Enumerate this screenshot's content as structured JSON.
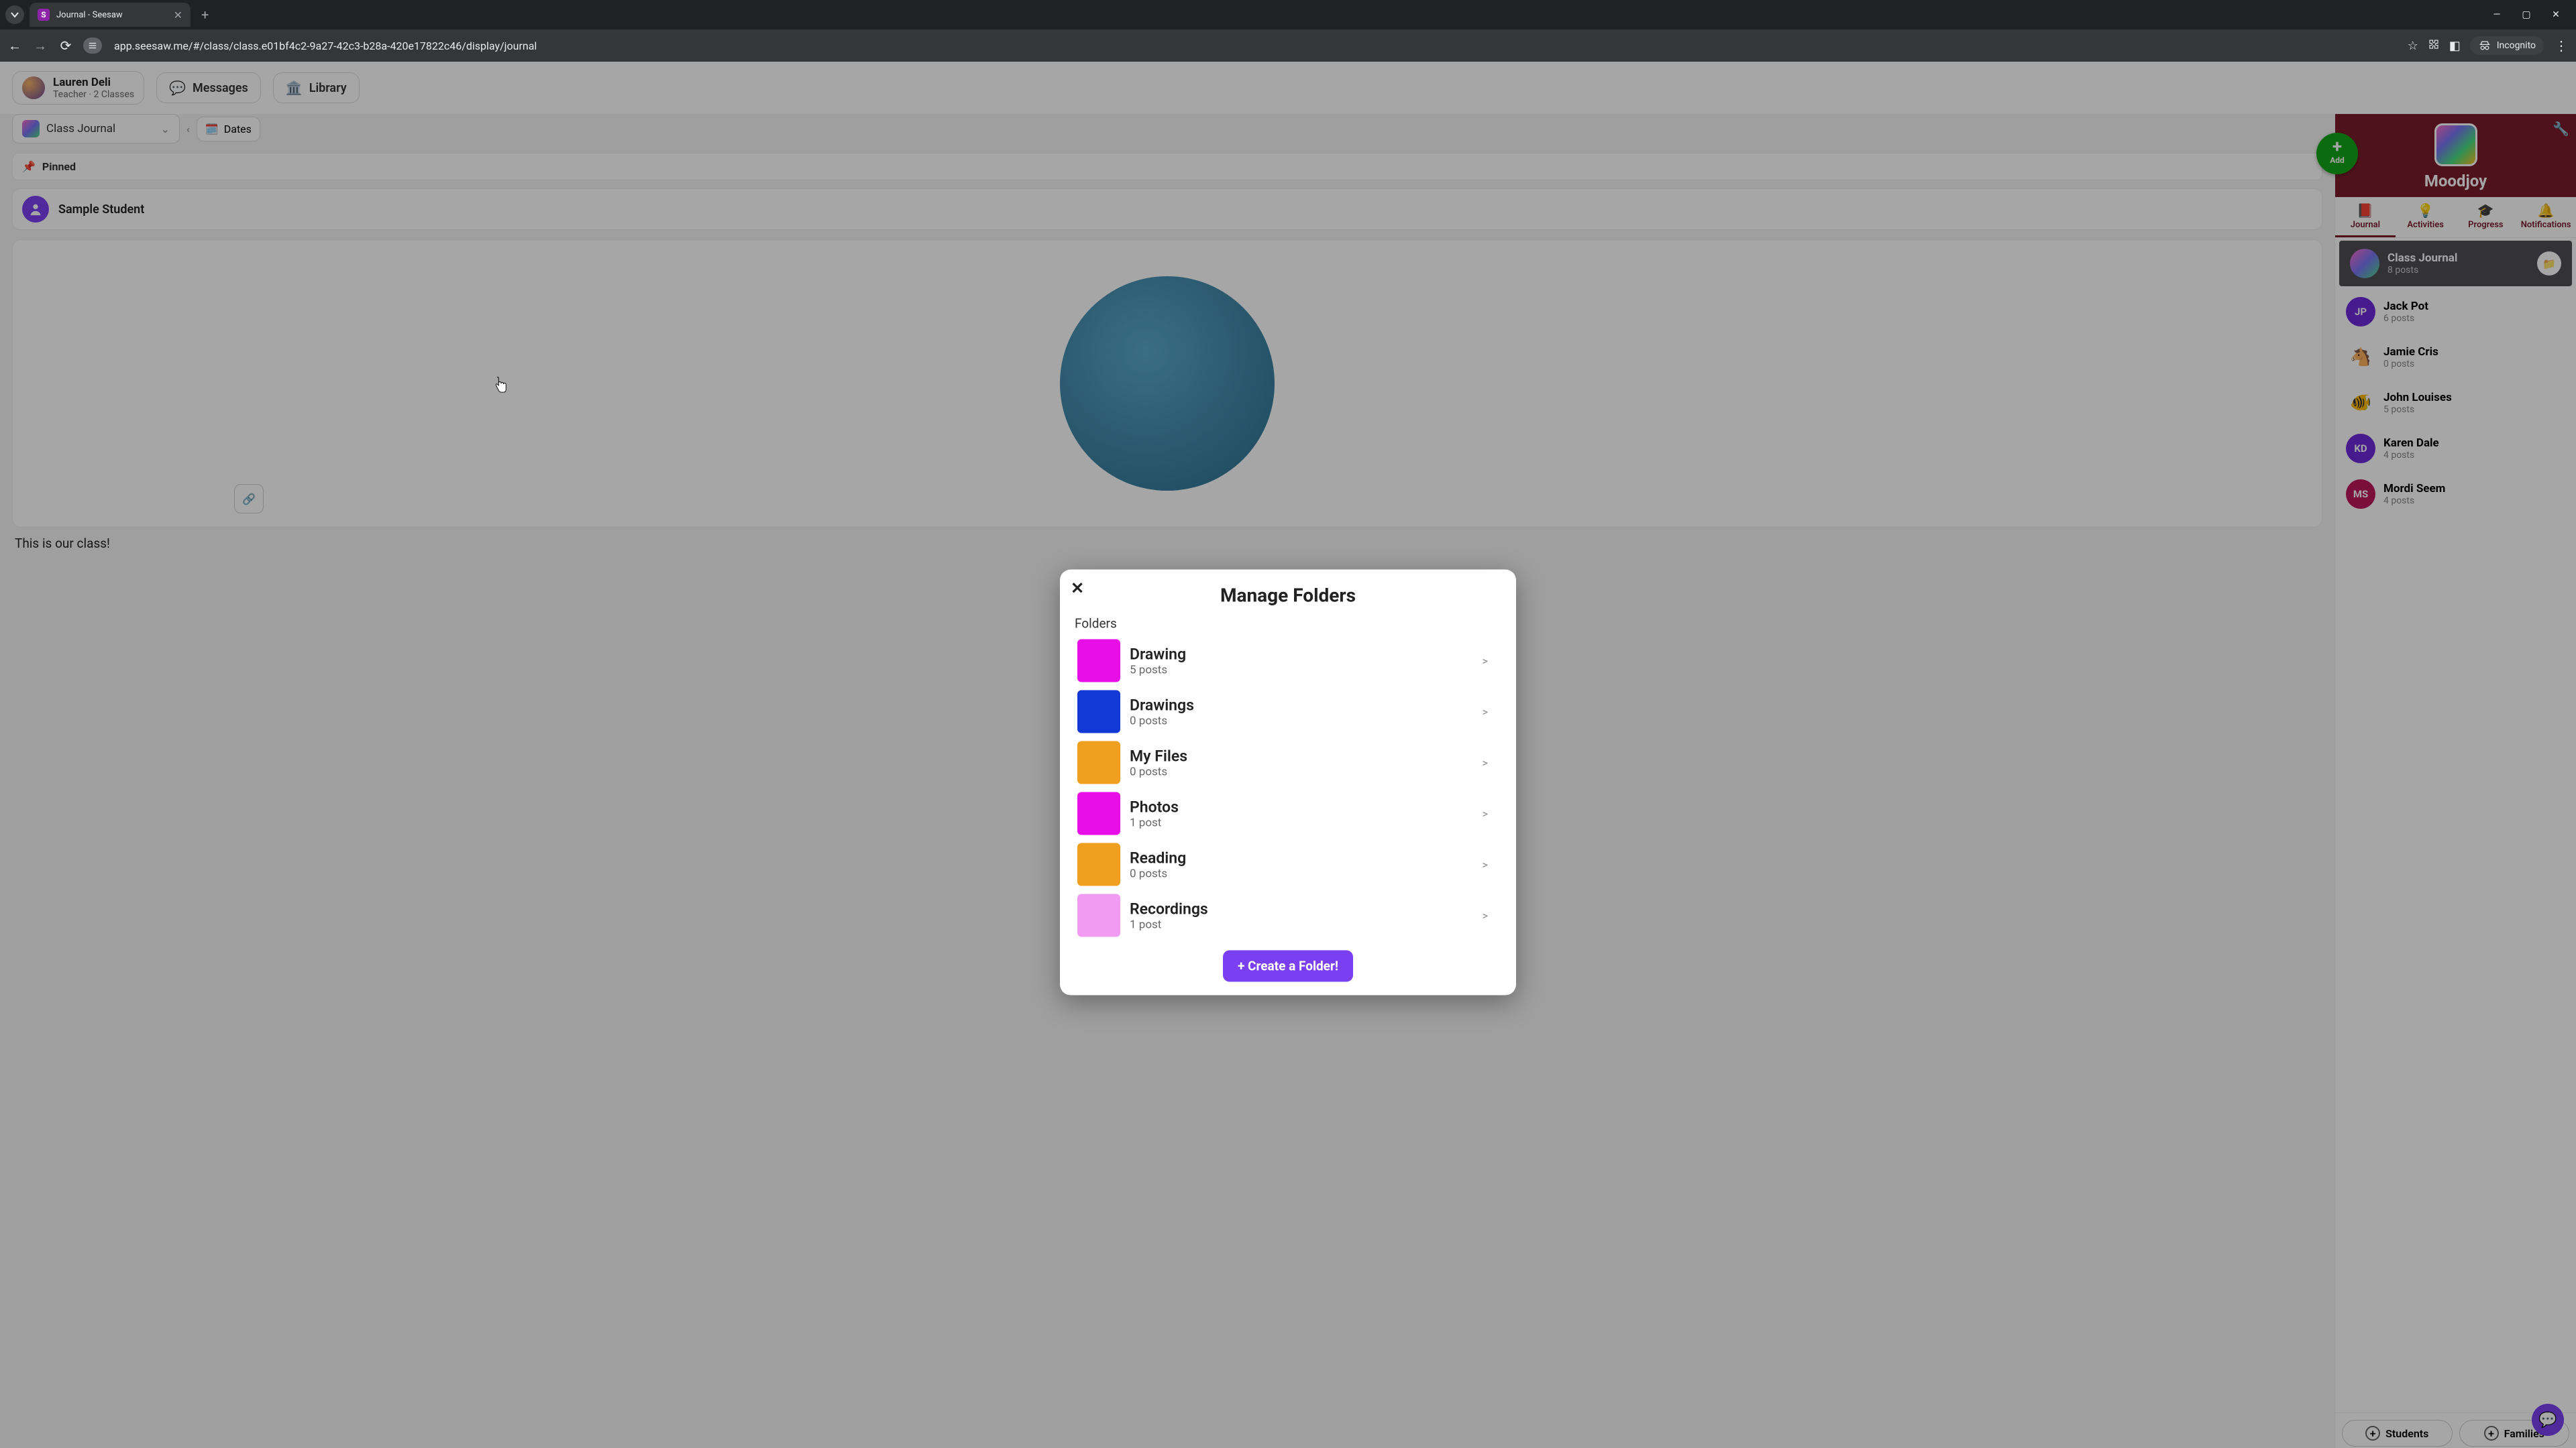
{
  "browser": {
    "tab_title": "Journal - Seesaw",
    "url": "app.seesaw.me/#/class/class.e01bf4c2-9a27-42c3-b28a-420e17822c46/display/journal",
    "incognito_label": "Incognito"
  },
  "header": {
    "teacher_name": "Lauren Deli",
    "teacher_sub": "Teacher · 2 Classes",
    "tab_messages": "Messages",
    "tab_library": "Library"
  },
  "journal_bar": {
    "selector_label": "Class Journal",
    "dates_label": "Dates"
  },
  "pinned_label": "Pinned",
  "sample_student": "Sample Student",
  "caption": "This is our class!",
  "add_fab": {
    "label": "Add"
  },
  "class": {
    "name": "Moodjoy"
  },
  "rail_tabs": {
    "journal": "Journal",
    "activities": "Activities",
    "progress": "Progress",
    "notifications": "Notifications"
  },
  "students": [
    {
      "name": "Class Journal",
      "sub": "8 posts",
      "avatar_type": "img",
      "selected": true,
      "show_folder": true
    },
    {
      "name": "Jack Pot",
      "sub": "6 posts",
      "avatar_type": "initials",
      "initials": "JP",
      "color": "#6d28d9"
    },
    {
      "name": "Jamie Cris",
      "sub": "0 posts",
      "avatar_type": "emoji",
      "emoji": "🐴"
    },
    {
      "name": "John Louises",
      "sub": "5 posts",
      "avatar_type": "emoji",
      "emoji": "🐠"
    },
    {
      "name": "Karen Dale",
      "sub": "4 posts",
      "avatar_type": "initials",
      "initials": "KD",
      "color": "#6d28d9"
    },
    {
      "name": "Mordi Seem",
      "sub": "4 posts",
      "avatar_type": "initials",
      "initials": "MS",
      "color": "#be185d"
    }
  ],
  "rail_footer": {
    "students": "Students",
    "families": "Families"
  },
  "modal": {
    "title": "Manage Folders",
    "section_label": "Folders",
    "create_label": "+ Create a Folder!",
    "folders": [
      {
        "name": "Drawing",
        "count": "5 posts",
        "color": "#e80ee8"
      },
      {
        "name": "Drawings",
        "count": "0 posts",
        "color": "#1238d6"
      },
      {
        "name": "My Files",
        "count": "0 posts",
        "color": "#f0a01e"
      },
      {
        "name": "Photos",
        "count": "1 post",
        "color": "#e80ee8"
      },
      {
        "name": "Reading",
        "count": "0 posts",
        "color": "#f0a01e"
      },
      {
        "name": "Recordings",
        "count": "1 post",
        "color": "#f29bf2"
      }
    ]
  }
}
